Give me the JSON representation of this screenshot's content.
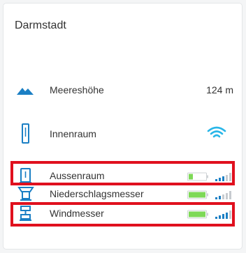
{
  "station": {
    "name": "Darmstadt"
  },
  "rows": [
    {
      "label": "Meereshöhe",
      "value": "124 m",
      "icon": "mountain-icon"
    },
    {
      "label": "Innenraum",
      "status_icon": "wifi-icon",
      "icon": "indoor-sensor-icon"
    },
    {
      "label": "Aussenraum",
      "battery_level": 0.25,
      "signal_bars": 3,
      "icon": "outdoor-sensor-icon"
    },
    {
      "label": "Niederschlagsmesser",
      "battery_level": 1.0,
      "signal_bars": 2,
      "icon": "rain-gauge-icon"
    },
    {
      "label": "Windmesser",
      "battery_level": 1.0,
      "signal_bars": 4,
      "icon": "anemometer-icon"
    }
  ],
  "colors": {
    "accent_blue": "#1b7fc4",
    "battery_green": "#7ed957",
    "highlight_red": "#e0101e",
    "inactive_gray": "#c7cbd0"
  }
}
